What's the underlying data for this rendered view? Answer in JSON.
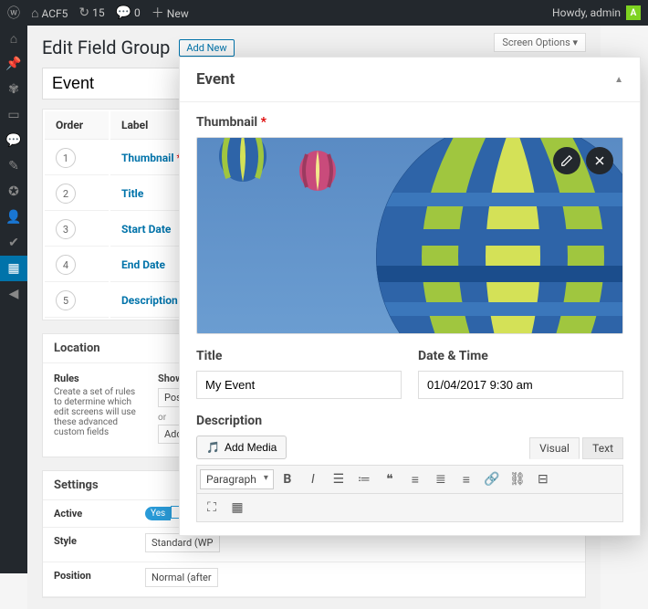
{
  "adminbar": {
    "site": "ACF5",
    "updates": "15",
    "comments": "0",
    "new": "New",
    "howdy": "Howdy, admin",
    "avatar_letter": "A"
  },
  "bg": {
    "screen_options": "Screen Options ▾",
    "page_title": "Edit Field Group",
    "add_new": "Add New",
    "group_name": "Event",
    "cols": {
      "order": "Order",
      "label": "Label"
    },
    "fields": [
      {
        "n": "1",
        "label": "Thumbnail",
        "req": true
      },
      {
        "n": "2",
        "label": "Title"
      },
      {
        "n": "3",
        "label": "Start Date"
      },
      {
        "n": "4",
        "label": "End Date"
      },
      {
        "n": "5",
        "label": "Description"
      }
    ],
    "location": {
      "heading": "Location",
      "rules_title": "Rules",
      "rules_help": "Create a set of rules to determine which edit screens will use these advanced custom fields",
      "show_label": "Show this field",
      "post_type": "Post Type",
      "or": "or",
      "add_rule": "Add rule group"
    },
    "settings": {
      "heading": "Settings",
      "active": "Active",
      "active_val": "Yes",
      "style": "Style",
      "style_val": "Standard (WP",
      "position": "Position",
      "position_val": "Normal (after"
    }
  },
  "fg": {
    "title": "Event",
    "thumbnail_label": "Thumbnail",
    "title_label": "Title",
    "title_value": "My Event",
    "date_label": "Date & Time",
    "date_value": "01/04/2017 9:30 am",
    "desc_label": "Description",
    "add_media": "Add Media",
    "tab_visual": "Visual",
    "tab_text": "Text",
    "format_sel": "Paragraph"
  }
}
